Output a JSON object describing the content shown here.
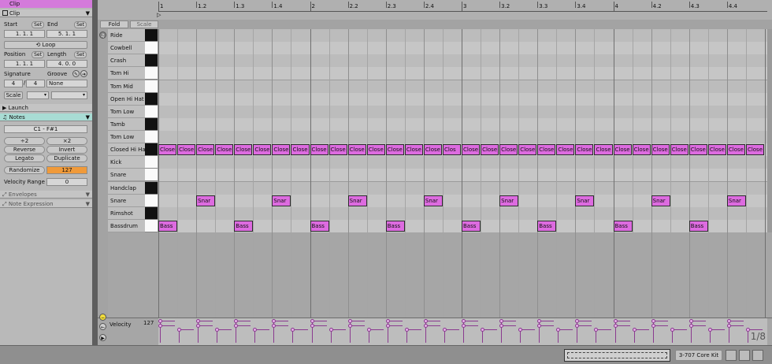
{
  "clip_title": "Clip",
  "clip_section": {
    "label": "Clip",
    "start_label": "Start",
    "start_value": "1.   1.   1",
    "end_label": "End",
    "end_value": "5.   1.   1",
    "set_label": "Set",
    "loop_label": "Loop",
    "position_label": "Position",
    "position_value": "1.   1.   1",
    "length_label": "Length",
    "length_value": "4.   0.   0",
    "signature_label": "Signature",
    "sig_num": "4",
    "sig_den": "4",
    "groove_label": "Groove",
    "groove_value": "None",
    "scale_label": "Scale"
  },
  "launch_label": "Launch",
  "notes_section": {
    "label": "Notes",
    "range": "C1 - F#1",
    "div2": "÷2",
    "mul2": "×2",
    "reverse": "Reverse",
    "invert": "Invert",
    "legato": "Legato",
    "duplicate": "Duplicate",
    "randomize": "Randomize",
    "randomize_value": "127",
    "velocity_range_label": "Velocity Range",
    "velocity_range_value": "0"
  },
  "envelopes_label": "Envelopes",
  "note_expression_label": "Note Expression",
  "editor": {
    "fold_label": "Fold",
    "scale_label": "Scale",
    "ruler_labels": [
      "1",
      "1.2",
      "1.3",
      "1.4",
      "2",
      "2.2",
      "2.3",
      "2.4",
      "3",
      "3.2",
      "3.3",
      "3.4",
      "4",
      "4.2",
      "4.3",
      "4.4"
    ],
    "rows": [
      {
        "name": "Ride",
        "black": true
      },
      {
        "name": "Cowbell",
        "black": false
      },
      {
        "name": "Crash",
        "black": true
      },
      {
        "name": "Tom Hi",
        "black": false
      },
      {
        "name": "Tom Mid",
        "black": false
      },
      {
        "name": "Open Hi Hat",
        "black": true
      },
      {
        "name": "Tom Low",
        "black": false
      },
      {
        "name": "Tamb",
        "black": true
      },
      {
        "name": "Tom Low",
        "black": false
      },
      {
        "name": "Closed Hi Hat",
        "black": true
      },
      {
        "name": "Kick",
        "black": false
      },
      {
        "name": "Snare",
        "black": false
      },
      {
        "name": "Handclap",
        "black": true
      },
      {
        "name": "Snare",
        "black": false
      },
      {
        "name": "Rimshot",
        "black": true
      },
      {
        "name": "Bassdrum",
        "black": false
      }
    ],
    "notes": {
      "closed_hi_hat": {
        "label": "Close",
        "short_label": "Clos",
        "row": 9,
        "steps": [
          0,
          1,
          2,
          3,
          4,
          5,
          6,
          7,
          8,
          9,
          10,
          11,
          12,
          13,
          14,
          15,
          16,
          17,
          18,
          19,
          20,
          21,
          22,
          23,
          24,
          25,
          26,
          27,
          28,
          29,
          30,
          31
        ]
      },
      "snare": {
        "label": "Snar",
        "row": 13,
        "steps": [
          2,
          6,
          10,
          14,
          18,
          22,
          26,
          30
        ]
      },
      "bassdrum": {
        "label": "Bass",
        "row": 15,
        "steps": [
          0,
          4,
          8,
          12,
          16,
          20,
          24,
          28
        ]
      }
    },
    "velocity_label": "Velocity",
    "velocity_max": "127",
    "grid_label": "1/8",
    "device_label": "3-707 Core Kit"
  }
}
